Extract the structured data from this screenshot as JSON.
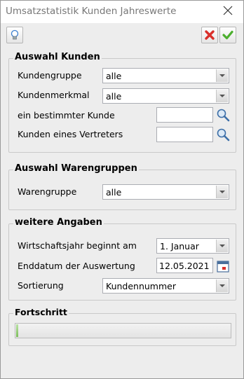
{
  "window": {
    "title": "Umsatzstatistik Kunden Jahreswerte"
  },
  "toolbar": {
    "hint_icon": "lightbulb-icon",
    "cancel_icon": "red-x-icon",
    "ok_icon": "green-check-icon"
  },
  "groups": {
    "kunden": {
      "title": "Auswahl Kunden",
      "kundengruppe_label": "Kundengruppe",
      "kundengruppe_value": "alle",
      "kundenmerkmal_label": "Kundenmerkmal",
      "kundenmerkmal_value": "alle",
      "bestimmter_kunde_label": "ein bestimmter Kunde",
      "bestimmter_kunde_value": "",
      "vertreter_label": "Kunden eines Vertreters",
      "vertreter_value": ""
    },
    "waren": {
      "title": "Auswahl Warengruppen",
      "warengruppe_label": "Warengruppe",
      "warengruppe_value": "alle"
    },
    "weitere": {
      "title": "weitere Angaben",
      "wirtschaftsjahr_label": "Wirtschaftsjahr beginnt am",
      "wirtschaftsjahr_value": "1. Januar",
      "enddatum_label": "Enddatum der Auswertung",
      "enddatum_value": "12.05.2021",
      "sortierung_label": "Sortierung",
      "sortierung_value": "Kundennummer"
    },
    "fortschritt": {
      "title": "Fortschritt",
      "progress": 0.01
    }
  },
  "colors": {
    "cancel": "#d9302b",
    "ok": "#4caf2e",
    "progress_fill": "#7bbd5a"
  }
}
